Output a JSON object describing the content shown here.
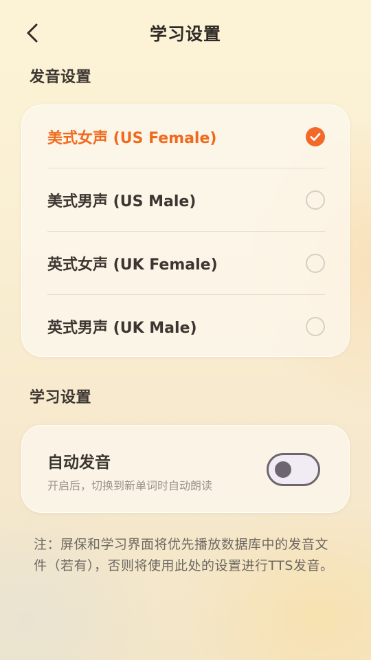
{
  "header": {
    "title": "学习设置",
    "back_icon": "chevron-left-icon"
  },
  "pronunciation_section": {
    "title": "发音设置",
    "options": [
      {
        "label": "美式女声 (US Female)",
        "selected": true
      },
      {
        "label": "美式男声 (US Male)",
        "selected": false
      },
      {
        "label": "英式女声 (UK Female)",
        "selected": false
      },
      {
        "label": "英式男声 (UK Male)",
        "selected": false
      }
    ]
  },
  "learning_section": {
    "title": "学习设置",
    "auto_play": {
      "title": "自动发音",
      "description": "开启后，切换到新单词时自动朗读",
      "enabled": false
    }
  },
  "note": "注：屏保和学习界面将优先播放数据库中的发音文件（若有），否则将使用此处的设置进行TTS发音。",
  "colors": {
    "accent": "#f06a1e",
    "check_fill": "#f2692a",
    "toggle_border": "#6d6670",
    "toggle_fill": "#f1ecf3",
    "text_primary": "#3b3631",
    "text_secondary": "#9a938b"
  }
}
